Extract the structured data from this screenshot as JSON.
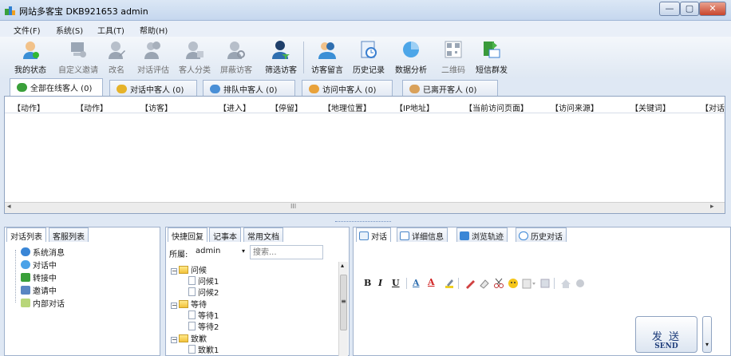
{
  "window": {
    "title": "网站多客宝  DKB921653  admin",
    "controls": {
      "minimize": "—",
      "maximize": "▢",
      "close": "✕"
    }
  },
  "menu": [
    "文件(F)",
    "系统(S)",
    "工具(T)",
    "帮助(H)"
  ],
  "toolbar": [
    {
      "label": "我的状态",
      "icon": "user-status-icon",
      "enabled": true
    },
    {
      "label": "自定义邀请",
      "icon": "custom-invite-icon",
      "enabled": false
    },
    {
      "label": "改名",
      "icon": "rename-icon",
      "enabled": false
    },
    {
      "label": "对话评估",
      "icon": "evaluate-icon",
      "enabled": false
    },
    {
      "label": "客人分类",
      "icon": "classify-icon",
      "enabled": false
    },
    {
      "label": "屏蔽访客",
      "icon": "block-visitor-icon",
      "enabled": false
    },
    {
      "label": "筛选访客",
      "icon": "filter-visitor-icon",
      "enabled": true
    },
    {
      "label": "访客留言",
      "icon": "visitor-message-icon",
      "enabled": true
    },
    {
      "label": "历史记录",
      "icon": "history-icon",
      "enabled": true
    },
    {
      "label": "数据分析",
      "icon": "data-analysis-icon",
      "enabled": true
    },
    {
      "label": "二维码",
      "icon": "qrcode-icon",
      "enabled": false
    },
    {
      "label": "短信群发",
      "icon": "sms-broadcast-icon",
      "enabled": true
    }
  ],
  "visitor_tabs": [
    "全部在线客人 (0)",
    "对话中客人 (0)",
    "排队中客人 (0)",
    "访问中客人 (0)",
    "已离开客人 (0)"
  ],
  "columns": [
    "【动作】",
    "【动作】",
    "【访客】",
    "【进入】",
    "【停留】",
    "【地理位置】",
    "【IP地址】",
    "【当前访问页面】",
    "【访问来源】",
    "【关键词】",
    "【对话"
  ],
  "left_panel": {
    "tabs": [
      "对话列表",
      "客服列表"
    ],
    "items": [
      "系统消息",
      "对话中",
      "转接中",
      "邀请中",
      "内部对话"
    ]
  },
  "middle_panel": {
    "tabs": [
      "快捷回复",
      "记事本",
      "常用文档"
    ],
    "owner_label": "所屬:",
    "owner_value": "admin",
    "search_placeholder": "搜索...",
    "groups": [
      {
        "name": "问候",
        "items": [
          "问候1",
          "问候2"
        ]
      },
      {
        "name": "等待",
        "items": [
          "等待1",
          "等待2"
        ]
      },
      {
        "name": "致歉",
        "items": [
          "致歉1"
        ]
      }
    ]
  },
  "chat_panel": {
    "tabs": [
      "对话",
      "详细信息",
      "浏览轨迹",
      "历史对话"
    ],
    "format": {
      "bold": "B",
      "italic": "I",
      "underline": "U",
      "size": "A",
      "color": "A"
    },
    "send_zh": "发 送",
    "send_en": "SEND"
  },
  "scroll_glyphs": {
    "left": "◂",
    "right": "▸",
    "up": "▴",
    "down": "▾",
    "grip": "≡",
    "mid": "III"
  },
  "colors": {
    "accent": "#3f6fb5",
    "tab_border": "#a4b7d2",
    "panel_border": "#9fb1cc",
    "bg": "#dfe8f4"
  }
}
